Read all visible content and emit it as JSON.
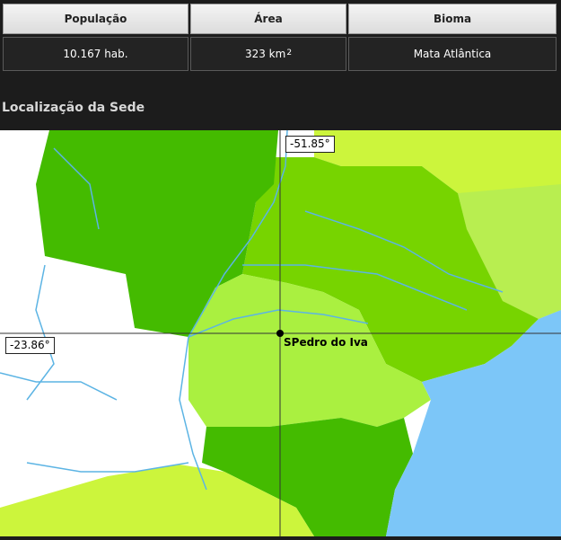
{
  "table": {
    "headers": [
      "População",
      "Área",
      "Bioma"
    ],
    "population": "10.167 hab.",
    "area_value": "323 km",
    "area_exp": "2",
    "biome": "Mata Atlântica"
  },
  "section_title": "Localização da Sede",
  "map": {
    "longitude_label": "-51.85°",
    "latitude_label": "-23.86°",
    "place_label": "SPedro do Iva",
    "colors": {
      "dark_green": "#44bb00",
      "mid_green": "#77d400",
      "light_green": "#aaf040",
      "yellow_green": "#ccf53c",
      "pale_green": "#b8ee50",
      "water": "#7cc6f8",
      "river": "#5cb4e4",
      "crosshair": "#333333"
    }
  }
}
